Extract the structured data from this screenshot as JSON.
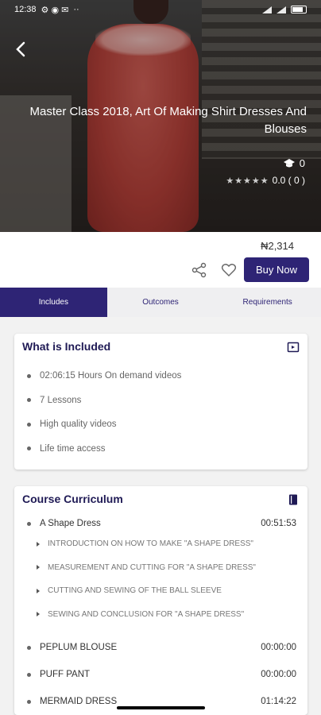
{
  "status": {
    "time": "12:38",
    "dots": "··",
    "battery": ""
  },
  "course": {
    "title": "Master Class 2018, Art Of Making Shirt Dresses And Blouses",
    "students": "0",
    "stars": "★★★★★",
    "rating": "0.0 ( 0 )",
    "price": "₦2,314",
    "buy_label": "Buy Now"
  },
  "tabs": [
    "Includes",
    "Outcomes",
    "Requirements"
  ],
  "included": {
    "title": "What is Included",
    "items": [
      "02:06:15 Hours On demand videos",
      "7 Lessons",
      "High quality videos",
      "Life time access"
    ]
  },
  "curriculum": {
    "title": "Course Curriculum",
    "sections": [
      {
        "name": "A Shape Dress",
        "time": "00:51:53",
        "lessons": [
          "INTRODUCTION ON HOW TO MAKE \"A SHAPE DRESS\"",
          "MEASUREMENT AND CUTTING FOR \"A SHAPE DRESS\"",
          "CUTTING AND SEWING OF THE BALL SLEEVE",
          "SEWING AND CONCLUSION FOR \"A SHAPE DRESS\""
        ]
      },
      {
        "name": "PEPLUM BLOUSE",
        "time": "00:00:00"
      },
      {
        "name": "PUFF PANT",
        "time": "00:00:00"
      },
      {
        "name": "MERMAID DRESS",
        "time": "01:14:22"
      }
    ]
  },
  "colors": {
    "primary": "#2e2475",
    "title": "#1f1a55"
  },
  "icons": [
    "back-arrow-icon",
    "graduation-cap-icon",
    "share-icon",
    "heart-icon",
    "video-icon",
    "book-icon"
  ]
}
